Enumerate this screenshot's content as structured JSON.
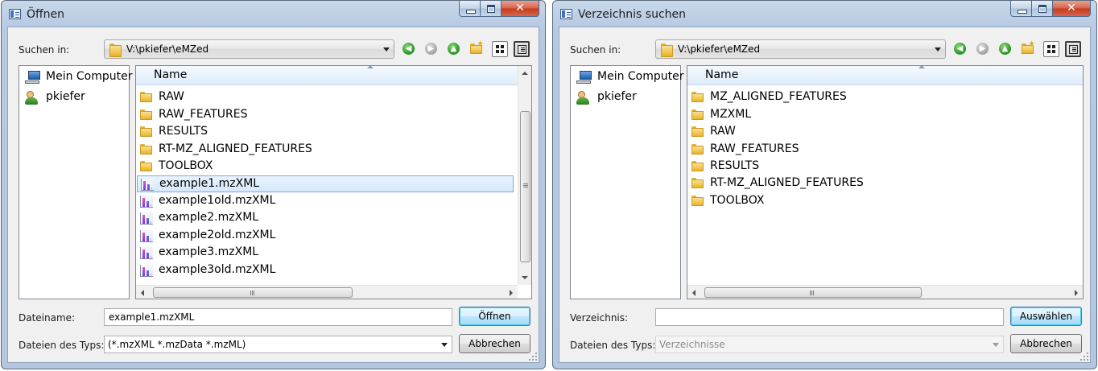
{
  "left_dialog": {
    "title": "Öffnen",
    "look_in_label": "Suchen in:",
    "path": "V:\\pkiefer\\eMZed",
    "places": [
      "Mein Computer",
      "pkiefer"
    ],
    "column_header": "Name",
    "files": [
      {
        "name": "RAW",
        "type": "folder"
      },
      {
        "name": "RAW_FEATURES",
        "type": "folder"
      },
      {
        "name": "RESULTS",
        "type": "folder"
      },
      {
        "name": "RT-MZ_ALIGNED_FEATURES",
        "type": "folder"
      },
      {
        "name": "TOOLBOX",
        "type": "folder"
      },
      {
        "name": "example1.mzXML",
        "type": "mzxml",
        "selected": true
      },
      {
        "name": "example1old.mzXML",
        "type": "mzxml"
      },
      {
        "name": "example2.mzXML",
        "type": "mzxml"
      },
      {
        "name": "example2old.mzXML",
        "type": "mzxml"
      },
      {
        "name": "example3.mzXML",
        "type": "mzxml"
      },
      {
        "name": "example3old.mzXML",
        "type": "mzxml"
      }
    ],
    "filename_label": "Dateiname:",
    "filename_value": "example1.mzXML",
    "filetype_label": "Dateien des Typs:",
    "filetype_value": "(*.mzXML *.mzData *.mzML)",
    "open_button": "Öffnen",
    "cancel_button": "Abbrechen",
    "scrollbar_grip": "≡",
    "hscroll_grip": "III"
  },
  "right_dialog": {
    "title": "Verzeichnis suchen",
    "look_in_label": "Suchen in:",
    "path": "V:\\pkiefer\\eMZed",
    "places": [
      "Mein Computer",
      "pkiefer"
    ],
    "column_header": "Name",
    "files": [
      {
        "name": "MZ_ALIGNED_FEATURES",
        "type": "folder"
      },
      {
        "name": "MZXML",
        "type": "folder"
      },
      {
        "name": "RAW",
        "type": "folder"
      },
      {
        "name": "RAW_FEATURES",
        "type": "folder"
      },
      {
        "name": "RESULTS",
        "type": "folder"
      },
      {
        "name": "RT-MZ_ALIGNED_FEATURES",
        "type": "folder"
      },
      {
        "name": "TOOLBOX",
        "type": "folder"
      }
    ],
    "directory_label": "Verzeichnis:",
    "directory_value": "",
    "filetype_label": "Dateien des Typs:",
    "filetype_value": "Verzeichnisse",
    "choose_button": "Auswählen",
    "cancel_button": "Abbrechen",
    "hscroll_grip": "III"
  },
  "colors": {
    "titlebar": "#b8cbe2",
    "close_button": "#c53b1f",
    "selection": "#d5e8fc",
    "folder": "#f0c64c",
    "nav_green": "#2e9a2a"
  }
}
